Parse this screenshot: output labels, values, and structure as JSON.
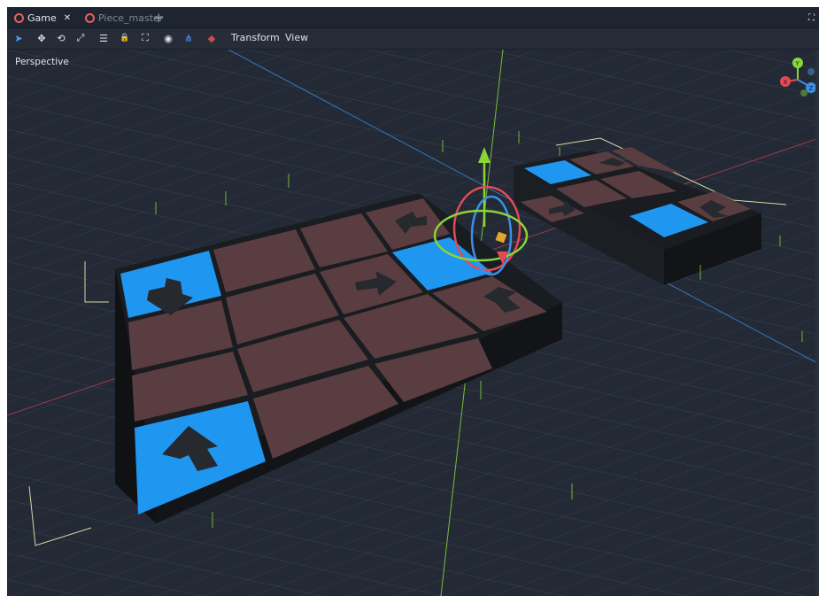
{
  "tabs": [
    {
      "label": "Game",
      "active": true
    },
    {
      "label": "Piece_master",
      "active": false
    }
  ],
  "add_tab_label": "+",
  "close_glyph": "✕",
  "toolbar": {
    "tools": [
      {
        "icon": "select-icon",
        "glyph": "➤",
        "color": "#4aa3ff"
      },
      {
        "icon": "move-icon",
        "glyph": "✥"
      },
      {
        "icon": "rotate-icon",
        "glyph": "⟲"
      },
      {
        "icon": "scale-icon",
        "glyph": "⤢"
      },
      {
        "icon": "list-icon",
        "glyph": "☰"
      },
      {
        "icon": "lock-icon",
        "glyph": "🔒"
      },
      {
        "icon": "group-icon",
        "glyph": "⛶"
      },
      {
        "icon": "local-space-icon",
        "glyph": "◉"
      },
      {
        "icon": "snap-icon",
        "glyph": "⋔",
        "color": "#4aa3ff"
      },
      {
        "icon": "camera-icon",
        "glyph": "◆",
        "color": "#d5494f"
      }
    ],
    "menus": [
      "Transform",
      "View"
    ]
  },
  "viewport": {
    "label": "Perspective",
    "background": "#232a35",
    "tiles": {
      "blue": "#1f96f0",
      "brown": "#5a3d40",
      "frame": "#16191d"
    },
    "gizmo_axes": [
      "X",
      "Y",
      "Z"
    ]
  },
  "colors": {
    "accent": "#4aa3ff",
    "scene_icon": "#e5605d",
    "axis_x": "#e54a54",
    "axis_y": "#8ad53a",
    "axis_z": "#3c8fe8"
  }
}
